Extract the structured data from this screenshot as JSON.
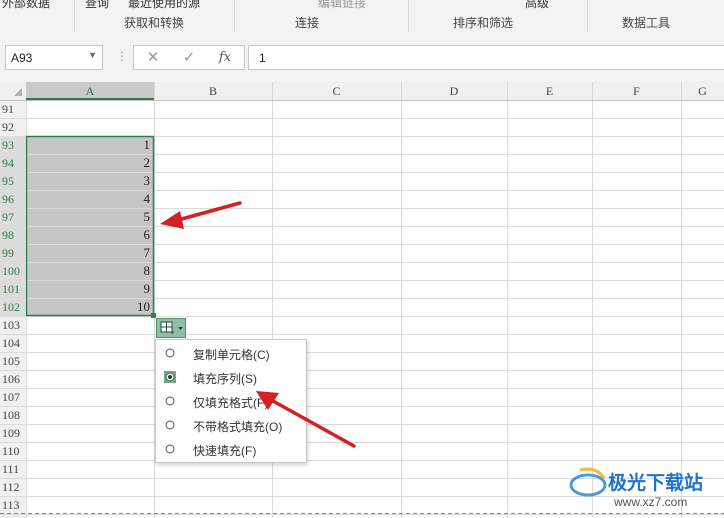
{
  "ribbon": {
    "items": {
      "external_data": "外部数据",
      "query": "查询",
      "recent_sources": "最近使用的源",
      "edit_links": "编辑链接",
      "advanced": "高级"
    },
    "groups": {
      "get_transform": "获取和转换",
      "connections": "连接",
      "sort_filter": "排序和筛选",
      "data_tools": "数据工具"
    }
  },
  "formula_bar": {
    "name_box": "A93",
    "cancel_glyph": "✕",
    "enter_glyph": "✓",
    "fx_glyph": "fx",
    "value": "1"
  },
  "grid": {
    "columns": [
      "A",
      "B",
      "C",
      "D",
      "E",
      "F",
      "G"
    ],
    "selected_column": "A",
    "rows": [
      "91",
      "92",
      "93",
      "94",
      "95",
      "96",
      "97",
      "98",
      "99",
      "100",
      "101",
      "102",
      "103",
      "104",
      "105",
      "106",
      "107",
      "108",
      "109",
      "110",
      "111",
      "112",
      "113"
    ],
    "selected_rows": [
      "93",
      "94",
      "95",
      "96",
      "97",
      "98",
      "99",
      "100",
      "101",
      "102"
    ],
    "cell_values": [
      "1",
      "2",
      "3",
      "4",
      "5",
      "6",
      "7",
      "8",
      "9",
      "10"
    ]
  },
  "autofill_menu": {
    "options": [
      {
        "label": "复制单元格(C)",
        "selected": false
      },
      {
        "label": "填充序列(S)",
        "selected": true
      },
      {
        "label": "仅填充格式(F)",
        "selected": false
      },
      {
        "label": "不带格式填充(O)",
        "selected": false
      },
      {
        "label": "快速填充(F)",
        "selected": false
      }
    ]
  },
  "watermark": {
    "brand": "极光下载站",
    "url": "www.xz7.com"
  },
  "colors": {
    "selection_border": "#2f7d4d",
    "selection_fill": "#c6c6c6",
    "arrow": "#d42020",
    "menu_highlight": "#6aad86"
  }
}
